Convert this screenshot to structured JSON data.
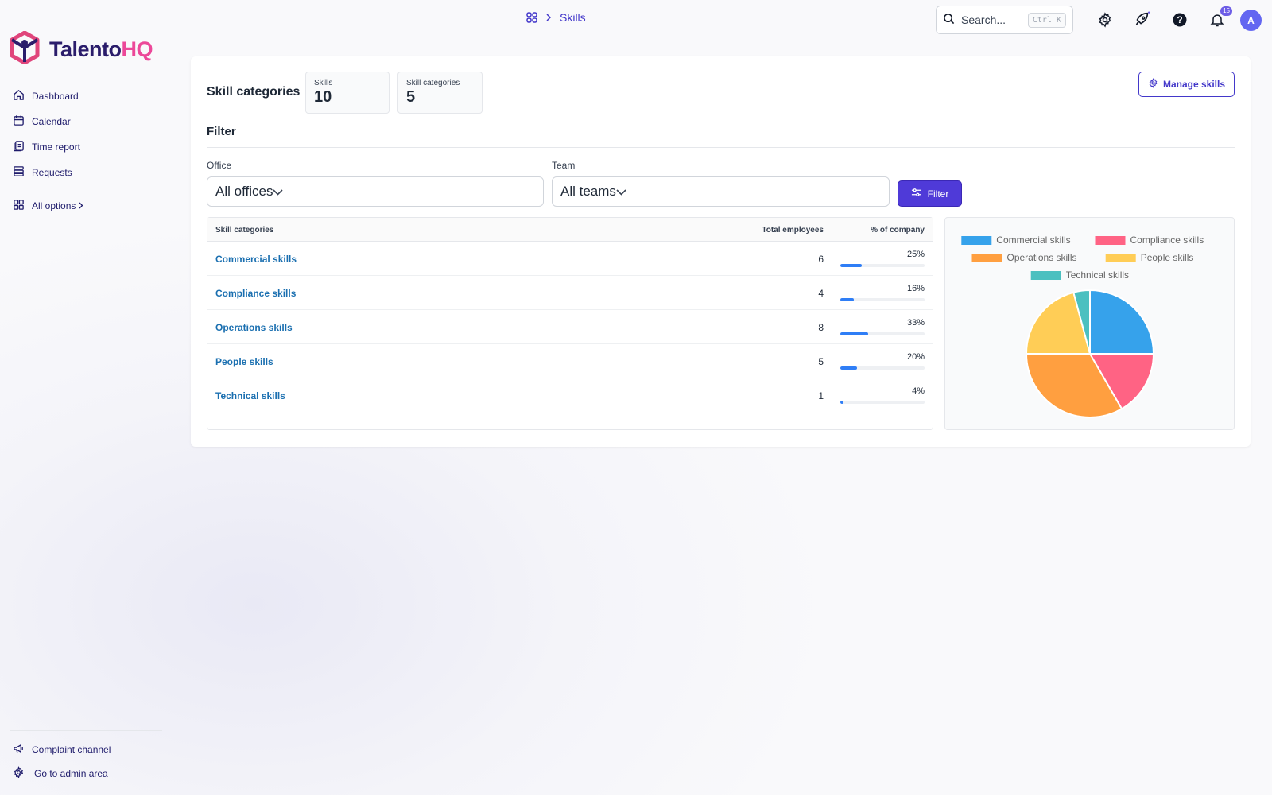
{
  "breadcrumb": {
    "current": "Skills"
  },
  "search": {
    "placeholder": "Search...",
    "shortcut": "Ctrl K"
  },
  "notifications": {
    "count": "15"
  },
  "user": {
    "initial": "A"
  },
  "brand": {
    "name_a": "Talento",
    "name_b": "HQ"
  },
  "sidebar": {
    "items": [
      {
        "label": "Dashboard",
        "icon": "home-icon"
      },
      {
        "label": "Calendar",
        "icon": "calendar-icon"
      },
      {
        "label": "Time report",
        "icon": "clipboard-icon"
      },
      {
        "label": "Requests",
        "icon": "stack-icon"
      }
    ],
    "all_options": "All options",
    "footer": [
      {
        "label": "Complaint channel",
        "icon": "megaphone-icon"
      },
      {
        "label": "Go to admin area",
        "icon": "gear-icon"
      }
    ]
  },
  "page": {
    "title": "Skill categories",
    "stats": [
      {
        "label": "Skills",
        "value": "10"
      },
      {
        "label": "Skill categories",
        "value": "5"
      }
    ],
    "manage_button": "Manage skills"
  },
  "filter": {
    "title": "Filter",
    "office": {
      "label": "Office",
      "value": "All offices"
    },
    "team": {
      "label": "Team",
      "value": "All teams"
    },
    "button": "Filter"
  },
  "table": {
    "headers": {
      "name": "Skill categories",
      "total": "Total employees",
      "pct": "% of company"
    },
    "rows": [
      {
        "name": "Commercial skills",
        "total": "6",
        "pct": "25%",
        "fraction": 0.25
      },
      {
        "name": "Compliance skills",
        "total": "4",
        "pct": "16%",
        "fraction": 0.16
      },
      {
        "name": "Operations skills",
        "total": "8",
        "pct": "33%",
        "fraction": 0.33
      },
      {
        "name": "People skills",
        "total": "5",
        "pct": "20%",
        "fraction": 0.2
      },
      {
        "name": "Technical skills",
        "total": "1",
        "pct": "4%",
        "fraction": 0.04
      }
    ]
  },
  "chart_data": {
    "type": "pie",
    "categories": [
      "Commercial skills",
      "Compliance skills",
      "Operations skills",
      "People skills",
      "Technical skills"
    ],
    "values": [
      6,
      4,
      8,
      5,
      1
    ],
    "colors": [
      "#36a2eb",
      "#ff6384",
      "#ff9f40",
      "#ffcd56",
      "#4bc0c0"
    ],
    "legend": "top"
  },
  "colors": {
    "accent": "#4338ca",
    "link": "#1a6fb0",
    "bar": "#2f7ef6"
  }
}
